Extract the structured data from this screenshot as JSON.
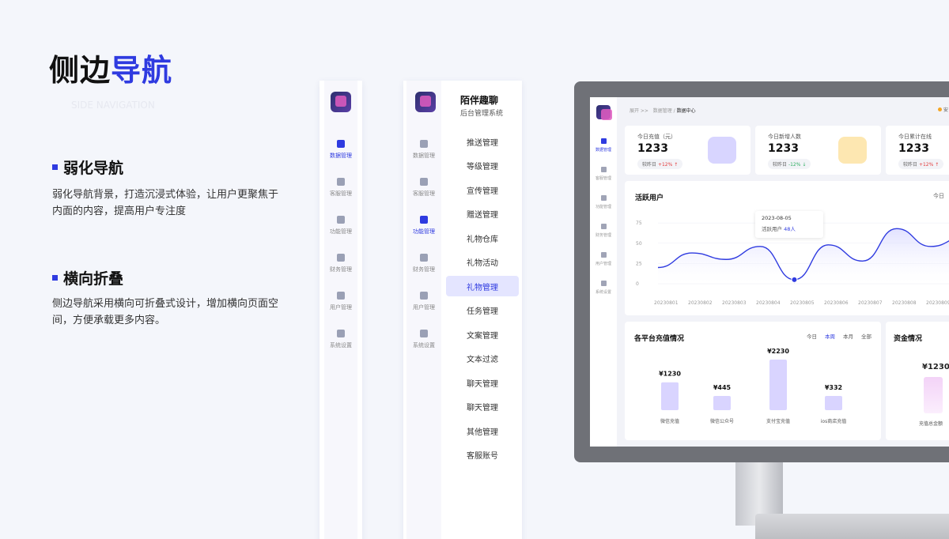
{
  "page": {
    "title_plain": "侧边",
    "title_highlight": "导航",
    "subtitle": "SIDE NAVIGATION"
  },
  "sections": [
    {
      "heading": "弱化导航",
      "body": "弱化导航背景，打造沉浸式体验，让用户更聚焦于内面的内容，提高用户专注度"
    },
    {
      "heading": "横向折叠",
      "body": "侧边导航采用横向可折叠式设计，增加横向页面空间，方便承载更多内容。"
    }
  ],
  "rail_nav": [
    {
      "label": "数据管理",
      "icon": "chart-icon",
      "active": true
    },
    {
      "label": "客服管理",
      "icon": "support-icon",
      "active": false
    },
    {
      "label": "功能管理",
      "icon": "function-icon",
      "active": false
    },
    {
      "label": "财务管理",
      "icon": "finance-icon",
      "active": false
    },
    {
      "label": "用户管理",
      "icon": "user-icon",
      "active": false
    },
    {
      "label": "系统设置",
      "icon": "settings-icon",
      "active": false
    }
  ],
  "expanded_panel": {
    "app_name": "陌伴趣聊",
    "app_subtitle": "后台管理系统",
    "rail": [
      {
        "label": "数据管理",
        "icon": "chart-icon",
        "active": false
      },
      {
        "label": "客服管理",
        "icon": "support-icon",
        "active": false
      },
      {
        "label": "功能管理",
        "icon": "function-icon",
        "active": true
      },
      {
        "label": "财务管理",
        "icon": "finance-icon",
        "active": false
      },
      {
        "label": "用户管理",
        "icon": "user-icon",
        "active": false
      },
      {
        "label": "系统设置",
        "icon": "settings-icon",
        "active": false
      }
    ],
    "menu": [
      {
        "label": "推送管理",
        "active": false
      },
      {
        "label": "等级管理",
        "active": false
      },
      {
        "label": "宣传管理",
        "active": false
      },
      {
        "label": "赠送管理",
        "active": false
      },
      {
        "label": "礼物仓库",
        "active": false
      },
      {
        "label": "礼物活动",
        "active": false
      },
      {
        "label": "礼物管理",
        "active": true
      },
      {
        "label": "任务管理",
        "active": false
      },
      {
        "label": "文案管理",
        "active": false
      },
      {
        "label": "文本过滤",
        "active": false
      },
      {
        "label": "聊天管理",
        "active": false
      },
      {
        "label": "聊天管理",
        "active": false
      },
      {
        "label": "其他管理",
        "active": false
      },
      {
        "label": "客服账号",
        "active": false
      }
    ]
  },
  "dashboard": {
    "breadcrumb_home": "展开 >>",
    "breadcrumb_parent": "数据管理",
    "breadcrumb_sep": "/",
    "breadcrumb_current": "数据中心",
    "top_right": "安",
    "side": [
      {
        "label": "数据管理",
        "active": true
      },
      {
        "label": "客服管理",
        "active": false
      },
      {
        "label": "功能管理",
        "active": false
      },
      {
        "label": "财务管理",
        "active": false
      },
      {
        "label": "用户管理",
        "active": false
      },
      {
        "label": "系统设置",
        "active": false
      }
    ],
    "kpis": [
      {
        "label": "今日充值（元）",
        "value": "1233",
        "compare": "较昨日",
        "delta": "+12%",
        "trend": "up"
      },
      {
        "label": "今日新增人数",
        "value": "1233",
        "compare": "较昨日",
        "delta": "-12%",
        "trend": "down"
      },
      {
        "label": "今日累计在线",
        "value": "1233",
        "compare": "较昨日",
        "delta": "+12%",
        "trend": "up"
      }
    ],
    "active_users": {
      "title": "活跃用户",
      "range_label": "今日",
      "tooltip_date": "2023-08-05",
      "tooltip_label": "活跃用户",
      "tooltip_value": "48人"
    },
    "recharge": {
      "title": "各平台充值情况",
      "filters": [
        "今日",
        "本周",
        "本月",
        "全部"
      ],
      "active_filter": "本周"
    },
    "funds": {
      "title": "资金情况",
      "value": "¥1230",
      "label": "充值总金额"
    }
  },
  "chart_data": [
    {
      "type": "area",
      "title": "活跃用户",
      "x": [
        "20230801",
        "20230802",
        "20230803",
        "20230804",
        "20230805",
        "20230806",
        "20230807",
        "20230808",
        "20230809"
      ],
      "values": [
        20,
        38,
        30,
        46,
        5,
        48,
        28,
        68,
        46,
        58
      ],
      "yticks": [
        0,
        25,
        50,
        75
      ],
      "ylim": [
        0,
        80
      ],
      "highlight_index": 4,
      "color": "#2f3be0"
    },
    {
      "type": "bar",
      "title": "各平台充值情况",
      "categories": [
        "微信充值",
        "微信公众号",
        "支付宝充值",
        "ios商店充值"
      ],
      "values": [
        1230,
        445,
        2230,
        332
      ],
      "value_labels": [
        "¥1230",
        "¥445",
        "¥2230",
        "¥332"
      ],
      "color": "#d9d4ff"
    }
  ],
  "colors": {
    "accent": "#2f3be0",
    "active_bg": "#e4e5ff",
    "up": "#e23b3b",
    "down": "#2fae62"
  }
}
